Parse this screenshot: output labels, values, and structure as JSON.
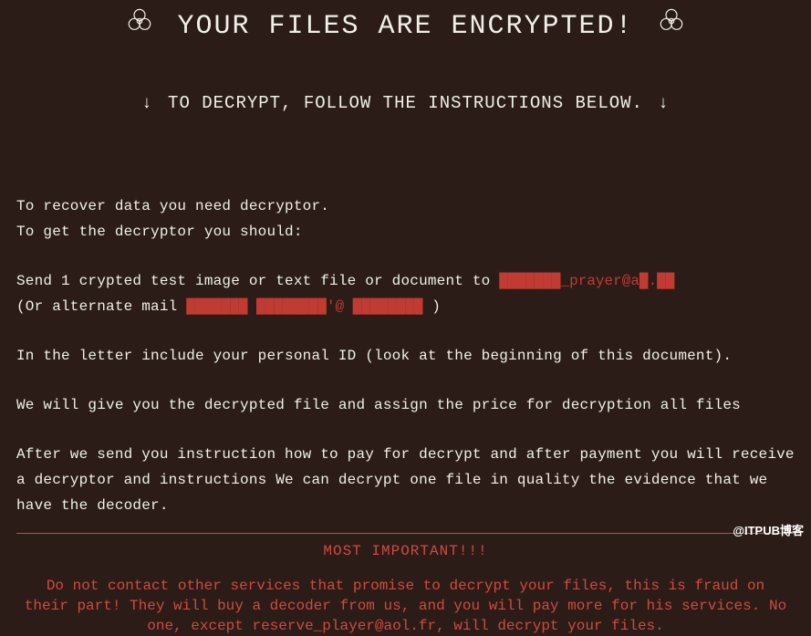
{
  "header": {
    "title": "YOUR FILES ARE ENCRYPTED!",
    "subtitle": "TO DECRYPT, FOLLOW THE INSTRUCTIONS BELOW.",
    "arrow_down": "↓"
  },
  "body": {
    "line1": "To recover data you need decryptor.",
    "line2": "To get the decryptor you should:",
    "line3a": "Send 1 crypted test image or text file or document to ",
    "email1_redacted": "███████_prayer@a█.██",
    "line4a": "(Or alternate mail ",
    "email2_redacted": "███████  ████████'@ ████████",
    "line4b": " )",
    "line5": "In the letter include your personal ID (look at the beginning of this document).",
    "line6": "We will give you the decrypted file and assign the price for decryption all files",
    "line7": "After we send you instruction how to pay for decrypt and after payment you will receive a decryptor and instructions We can decrypt one file in quality the evidence that we have the decoder."
  },
  "important": {
    "title": "MOST IMPORTANT!!!",
    "text": "Do not contact other services that promise to decrypt your files, this is fraud on their part! They will buy a decoder from us, and you will pay more for his services. No one, except reserve_player@aol.fr, will decrypt your files."
  },
  "watermark": "@ITPUB博客"
}
